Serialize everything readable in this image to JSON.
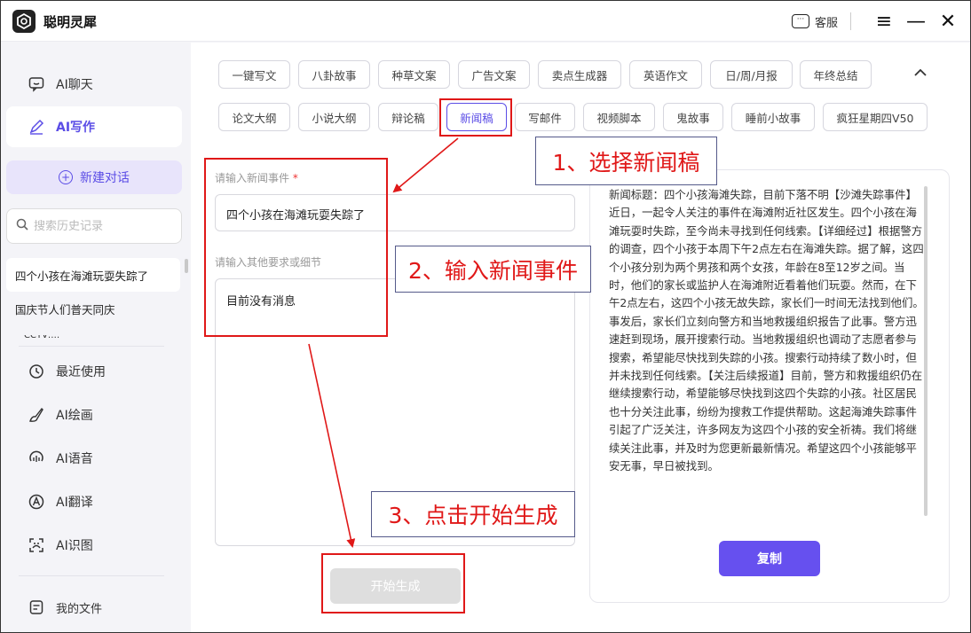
{
  "app": {
    "name": "聪明灵犀",
    "logo_icon": "hexagon-logo-icon"
  },
  "titlebar": {
    "service_label": "客服",
    "service_icon": "chat-bubble-icon"
  },
  "sidebar": {
    "top_items": [
      {
        "label": "AI聊天",
        "icon": "chat-icon"
      },
      {
        "label": "AI写作",
        "icon": "pen-icon",
        "active": true
      }
    ],
    "new_chat_label": "新建对话",
    "search_placeholder": "搜索历史记录",
    "history": [
      "四个小孩在海滩玩耍失踪了",
      "国庆节人们普天同庆",
      "CCTV……"
    ],
    "bottom_items": [
      {
        "label": "最近使用",
        "icon": "clock-icon"
      },
      {
        "label": "AI绘画",
        "icon": "paint-brush-icon"
      },
      {
        "label": "AI语音",
        "icon": "voice-icon"
      },
      {
        "label": "AI翻译",
        "icon": "translate-icon"
      },
      {
        "label": "AI识图",
        "icon": "scan-image-icon"
      }
    ],
    "files_label": "我的文件"
  },
  "categories": {
    "row1": [
      "一键写文",
      "八卦故事",
      "种草文案",
      "广告文案",
      "卖点生成器",
      "英语作文",
      "日/周/月报",
      "年终总结"
    ],
    "row2": [
      "论文大纲",
      "小说大纲",
      "辩论稿",
      "新闻稿",
      "写邮件",
      "视频脚本",
      "鬼故事",
      "睡前小故事",
      "疯狂星期四V50"
    ],
    "active": "新闻稿"
  },
  "form": {
    "event_label": "请输入新闻事件",
    "required_mark": "*",
    "event_value": "四个小孩在海滩玩耍失踪了",
    "detail_label": "请输入其他要求或细节",
    "detail_value": "目前没有消息",
    "generate_label": "开始生成"
  },
  "result": {
    "text": "新闻标题：四个小孩海滩失踪，目前下落不明【沙滩失踪事件】近日，一起令人关注的事件在海滩附近社区发生。四个小孩在海滩玩耍时失踪，至今尚未寻找到任何线索。【详细经过】根据警方的调查，四个小孩于本周下午2点左右在海滩失踪。据了解，这四个小孩分别为两个男孩和两个女孩，年龄在8至12岁之间。当时，他们的家长或监护人在海滩附近看着他们玩耍。然而，在下午2点左右，这四个小孩无故失踪，家长们一时间无法找到他们。事发后，家长们立刻向警方和当地救援组织报告了此事。警方迅速赶到现场，展开搜索行动。当地救援组织也调动了志愿者参与搜索，希望能尽快找到失踪的小孩。搜索行动持续了数小时，但并未找到任何线索。【关注后续报道】目前，警方和救援组织仍在继续搜索行动，希望能够尽快找到这四个失踪的小孩。社区居民也十分关注此事，纷纷为搜救工作提供帮助。这起海滩失踪事件引起了广泛关注，许多网友为这四个小孩的安全祈祷。我们将继续关注此事，并及时为您更新最新情况。希望这四个小孩能够平安无事，早日被找到。",
    "copy_label": "复制"
  },
  "annotations": {
    "step1": "1、选择新闻稿",
    "step2": "2、输入新闻事件",
    "step3": "3、点击开始生成",
    "color": "#e01818"
  }
}
